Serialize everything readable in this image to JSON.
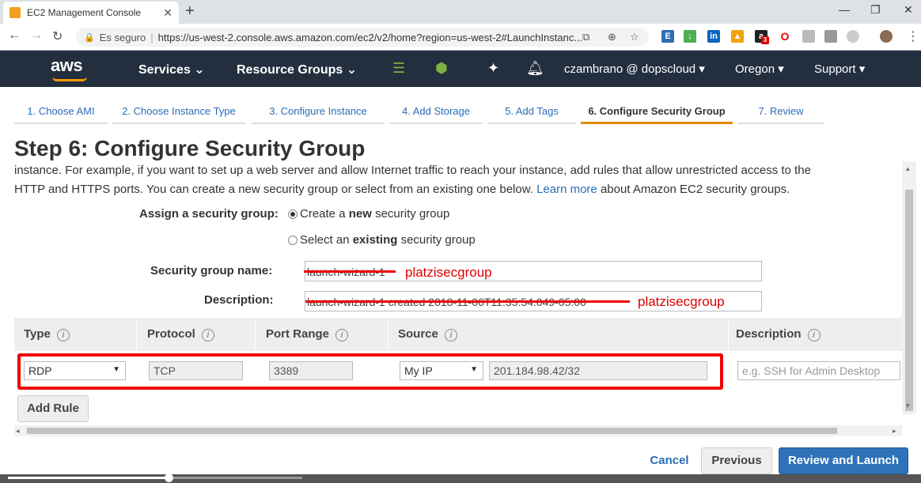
{
  "browser": {
    "tab_title": "EC2 Management Console",
    "tab_close": "✕",
    "new_tab": "+",
    "minimize": "—",
    "restore": "❐",
    "close": "✕",
    "secure_label": "Es seguro",
    "url": "https://us-west-2.console.aws.amazon.com/ec2/v2/home?region=us-west-2#LaunchInstanc...",
    "extension_badge": "3"
  },
  "aws_nav": {
    "logo": "aws",
    "services": "Services",
    "resource_groups": "Resource Groups",
    "user": "czambrano @ dopscloud",
    "region": "Oregon",
    "support": "Support"
  },
  "wizard_tabs": [
    {
      "label": "1. Choose AMI"
    },
    {
      "label": "2. Choose Instance Type"
    },
    {
      "label": "3. Configure Instance"
    },
    {
      "label": "4. Add Storage"
    },
    {
      "label": "5. Add Tags"
    },
    {
      "label": "6. Configure Security Group"
    },
    {
      "label": "7. Review"
    }
  ],
  "step": {
    "title": "Step 6: Configure Security Group",
    "desc_line1": "instance. For example, if you want to set up a web server and allow Internet traffic to reach your instance, add rules that allow unrestricted access to the",
    "desc_line2_pre": "HTTP and HTTPS ports. You can create a new security group or select from an existing one below. ",
    "desc_link": "Learn more",
    "desc_line2_post": " about Amazon EC2 security groups."
  },
  "form": {
    "assign_label": "Assign a security group:",
    "radio_new_pre": "Create a ",
    "radio_new_bold": "new",
    "radio_new_post": " security group",
    "radio_existing_pre": "Select an ",
    "radio_existing_bold": "existing",
    "radio_existing_post": " security group",
    "name_label": "Security group name:",
    "name_value": "launch-wizard-1",
    "name_annotation": "platzisecgroup",
    "desc_label": "Description:",
    "desc_value": "launch-wizard-1 created 2018-11-06T11:35:54.049-05:00",
    "desc_annotation": "platzisecgroup"
  },
  "rules_table": {
    "headers": [
      "Type",
      "Protocol",
      "Port Range",
      "Source",
      "Description"
    ],
    "info_glyph": "i",
    "row": {
      "type": "RDP",
      "protocol": "TCP",
      "port_range": "3389",
      "source": "My IP",
      "cidr": "201.184.98.42/32",
      "description_placeholder": "e.g. SSH for Admin Desktop"
    }
  },
  "buttons": {
    "add_rule": "Add Rule",
    "cancel": "Cancel",
    "previous": "Previous",
    "review_launch": "Review and Launch"
  },
  "video": {
    "progress": 0.18,
    "buffered": 0.33
  }
}
